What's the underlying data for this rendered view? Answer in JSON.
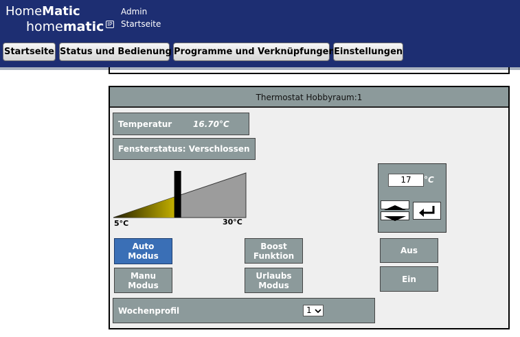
{
  "header": {
    "logo_top_light": "Home",
    "logo_top_bold": "Matic",
    "logo_bottom_light": "home",
    "logo_bottom_bold": "matic",
    "logo_badge": "IP",
    "user": "Admin",
    "page": "Startseite",
    "background_color": "#1d2e72"
  },
  "nav": {
    "items": [
      {
        "label": "Startseite"
      },
      {
        "label": "Status und Bedienung"
      },
      {
        "label": "Programme und Verknüpfungen"
      },
      {
        "label": "Einstellungen"
      }
    ]
  },
  "panel": {
    "title": "Thermostat Hobbyraum:1",
    "temperature_label": "Temperatur",
    "temperature_value": "16.70°C",
    "window_status": "Fensterstatus: Verschlossen",
    "scale_min": "5°C",
    "scale_max": "30°C",
    "scale_min_value": 5,
    "scale_max_value": 30,
    "current_value_on_scale": 17,
    "setpoint_value": "17",
    "setpoint_unit": "°C",
    "modes": [
      {
        "label": "Auto Modus",
        "active": true
      },
      {
        "label": "Manu Modus",
        "active": false
      },
      {
        "label": "Boost Funktion",
        "active": false
      },
      {
        "label": "Urlaubs Modus",
        "active": false
      }
    ],
    "off_label": "Aus",
    "on_label": "Ein",
    "week_profile_label": "Wochenprofil",
    "week_profile_value": "1",
    "accent_active": "#3a6fb6",
    "box_color": "#8c9a9b"
  }
}
